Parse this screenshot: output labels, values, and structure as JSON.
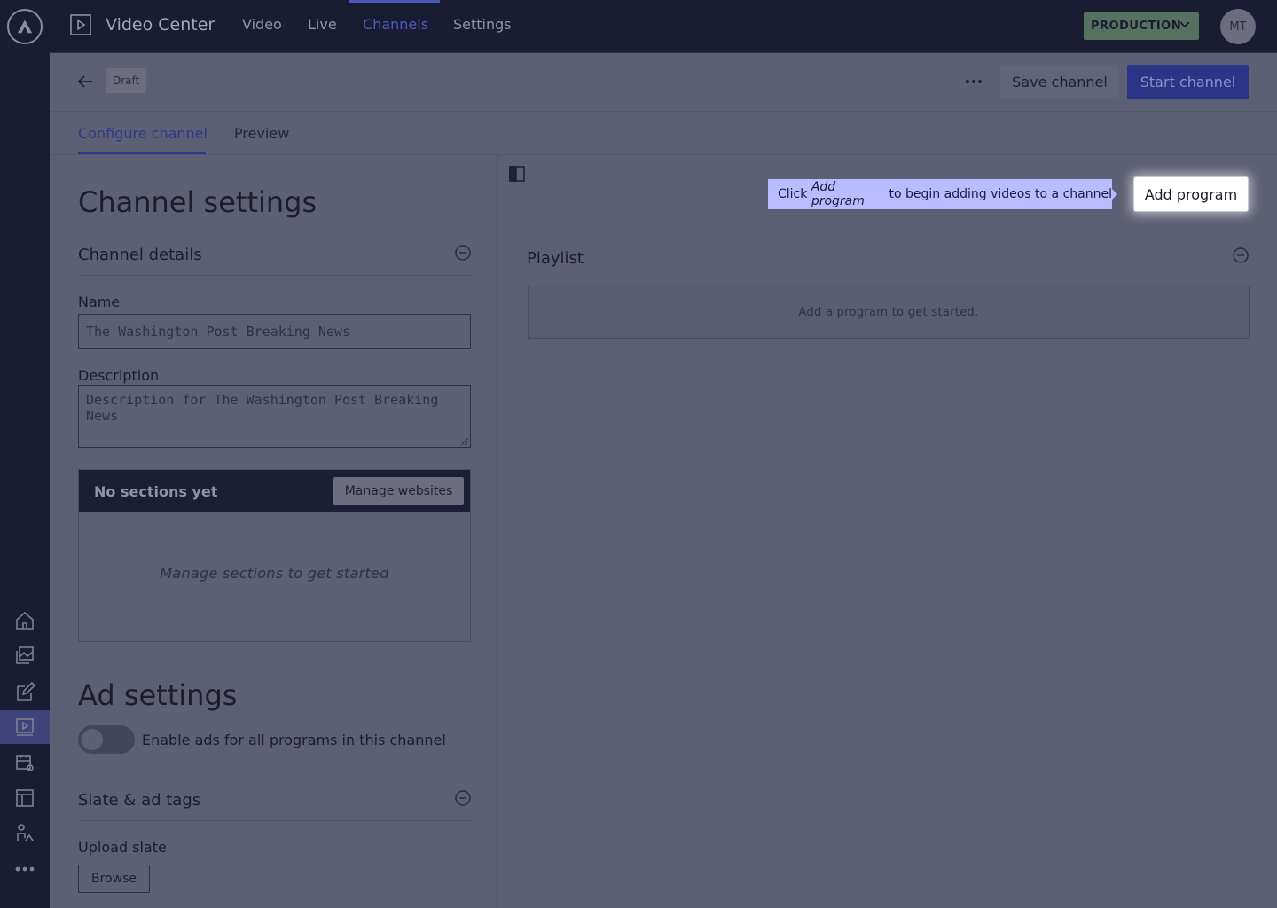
{
  "app": {
    "title": "Video Center",
    "nav_tabs": [
      "Video",
      "Live",
      "Channels",
      "Settings"
    ],
    "active_nav_tab": "Channels",
    "environment": "PRODUCTION",
    "user_initials": "MT"
  },
  "rail": {
    "items": [
      "home-icon",
      "photos-icon",
      "edit-icon",
      "video-icon",
      "calendar-settings-icon",
      "table-icon",
      "people-icon",
      "more-icon"
    ],
    "active_item": "video-icon"
  },
  "header": {
    "status_badge": "Draft",
    "save_label": "Save channel",
    "start_label": "Start channel"
  },
  "page_tabs": [
    "Configure channel",
    "Preview"
  ],
  "left": {
    "heading": "Channel settings",
    "details_title": "Channel details",
    "name_label": "Name",
    "name_placeholder": "The Washington Post Breaking News",
    "description_label": "Description",
    "description_placeholder": "Description for The Washington Post Breaking News",
    "sections_title": "No sections yet",
    "manage_websites_label": "Manage websites",
    "sections_empty": "Manage sections to get started",
    "ad_heading": "Ad settings",
    "ads_toggle_label": "Enable ads for all programs in this channel",
    "slate_title": "Slate & ad tags",
    "upload_slate_label": "Upload slate",
    "browse_label": "Browse"
  },
  "right": {
    "tooltip_prefix": "Click ",
    "tooltip_emphasis": "Add program",
    "tooltip_suffix": " to begin adding videos to a channel",
    "add_program_label": "Add program",
    "playlist_title": "Playlist",
    "playlist_empty": "Add a program to get started."
  },
  "colors": {
    "rail_bg": "#1a1c33",
    "accent": "#4b5bb7",
    "environment_badge": "#54725f",
    "tooltip_bg": "#b7bdff"
  }
}
